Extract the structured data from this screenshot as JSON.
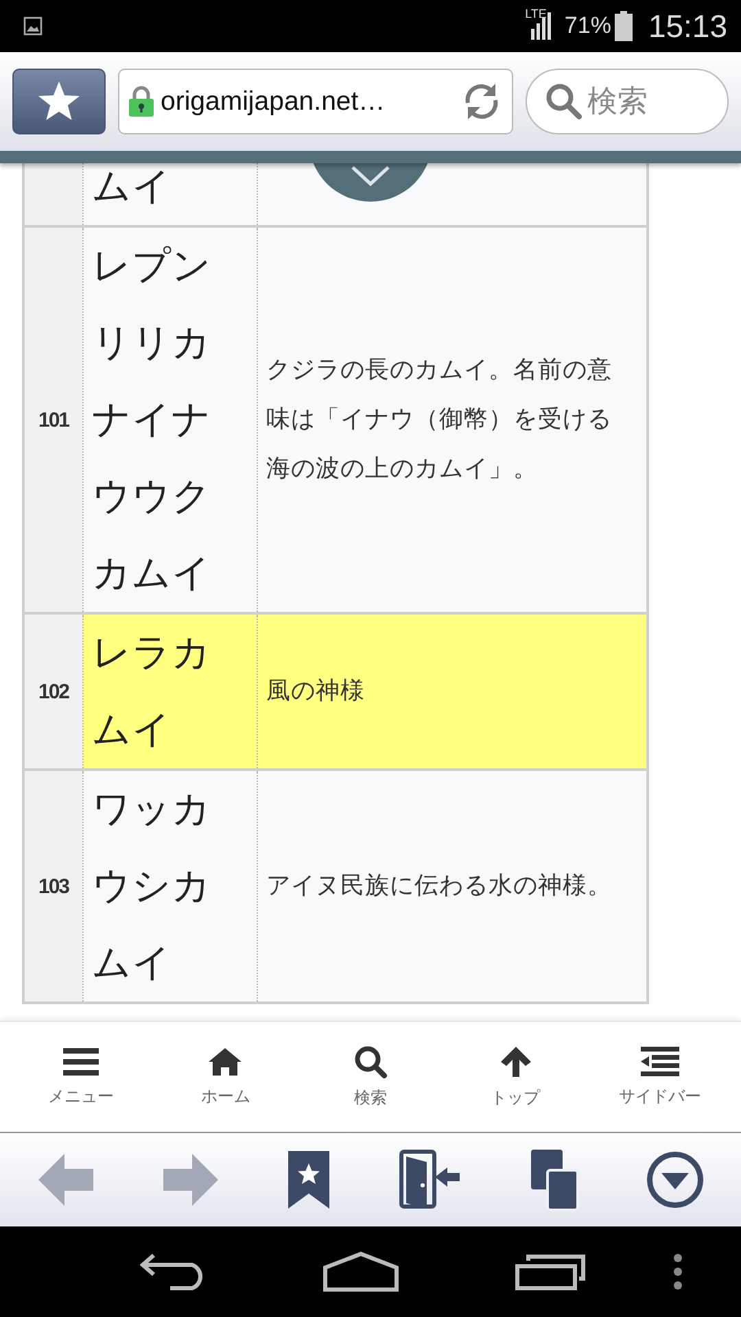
{
  "status_bar": {
    "network": "LTE",
    "battery": "71%",
    "time": "15:13"
  },
  "browser_bar": {
    "url": "origamijapan.net…",
    "search_placeholder": "検索"
  },
  "table": {
    "rows": [
      {
        "name": "ムイ",
        "highlighted": false
      },
      {
        "number": "101",
        "name": "レプンリリカナイナウウクカムイ",
        "description": "クジラの長のカムイ。名前の意味は「イナウ（御幣）を受ける海の波の上のカムイ」。",
        "highlighted": false
      },
      {
        "number": "102",
        "name": "レラカムイ",
        "description": "風の神様",
        "highlighted": true
      },
      {
        "number": "103",
        "name": "ワッカウシカムイ",
        "description": "アイヌ民族に伝わる水の神様。",
        "highlighted": false
      }
    ]
  },
  "bottom_nav": [
    {
      "kind": "menu",
      "label": "メニュー"
    },
    {
      "kind": "home",
      "label": "ホーム"
    },
    {
      "kind": "search",
      "label": "検索"
    },
    {
      "kind": "top",
      "label": "トップ"
    },
    {
      "kind": "sidebar",
      "label": "サイドバー"
    }
  ],
  "toolbar": [
    {
      "kind": "back",
      "disabled": true
    },
    {
      "kind": "forward",
      "disabled": true
    },
    {
      "kind": "bookmarks",
      "disabled": false
    },
    {
      "kind": "exit",
      "disabled": false
    },
    {
      "kind": "tabs",
      "disabled": false
    },
    {
      "kind": "more",
      "disabled": false
    }
  ]
}
